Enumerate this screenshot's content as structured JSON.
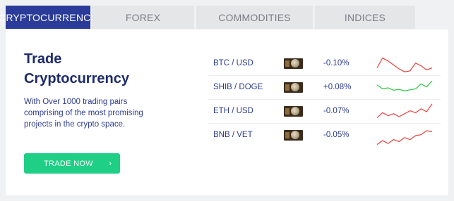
{
  "tabs": [
    {
      "label": "CRYPTOCURRENCY",
      "active": true
    },
    {
      "label": "FOREX",
      "active": false
    },
    {
      "label": "COMMODITIES",
      "active": false
    },
    {
      "label": "INDICES",
      "active": false
    }
  ],
  "hero": {
    "title": "Trade Cryptocurrency",
    "description": "With Over 1000 trading pairs comprising of the most promising projects in the crypto space.",
    "button_label": "TRADE NOW",
    "button_icon": "chevron-right-icon"
  },
  "colors": {
    "accent": "#2a3b9a",
    "button": "#1fcf85",
    "negative": "#e8413c",
    "positive": "#28c940"
  },
  "pairs": [
    {
      "pair": "BTC / USD",
      "change": "-0.10%",
      "trend": "negative",
      "spark": [
        0.7,
        0.2,
        0.35,
        0.55,
        0.75,
        0.9,
        0.85,
        0.45,
        0.6,
        0.8,
        0.7
      ]
    },
    {
      "pair": "SHIB / DOGE",
      "change": "+0.08%",
      "trend": "positive",
      "spark": [
        0.35,
        0.55,
        0.5,
        0.62,
        0.58,
        0.65,
        0.6,
        0.55,
        0.3,
        0.45,
        0.15
      ]
    },
    {
      "pair": "ETH / USD",
      "change": "-0.07%",
      "trend": "negative",
      "spark": [
        0.8,
        0.55,
        0.7,
        0.6,
        0.75,
        0.6,
        0.45,
        0.55,
        0.35,
        0.5,
        0.1
      ]
    },
    {
      "pair": "BNB / VET",
      "change": "-0.05%",
      "trend": "negative",
      "spark": [
        0.95,
        0.75,
        0.9,
        0.7,
        0.8,
        0.6,
        0.7,
        0.5,
        0.45,
        0.25,
        0.3
      ]
    }
  ]
}
